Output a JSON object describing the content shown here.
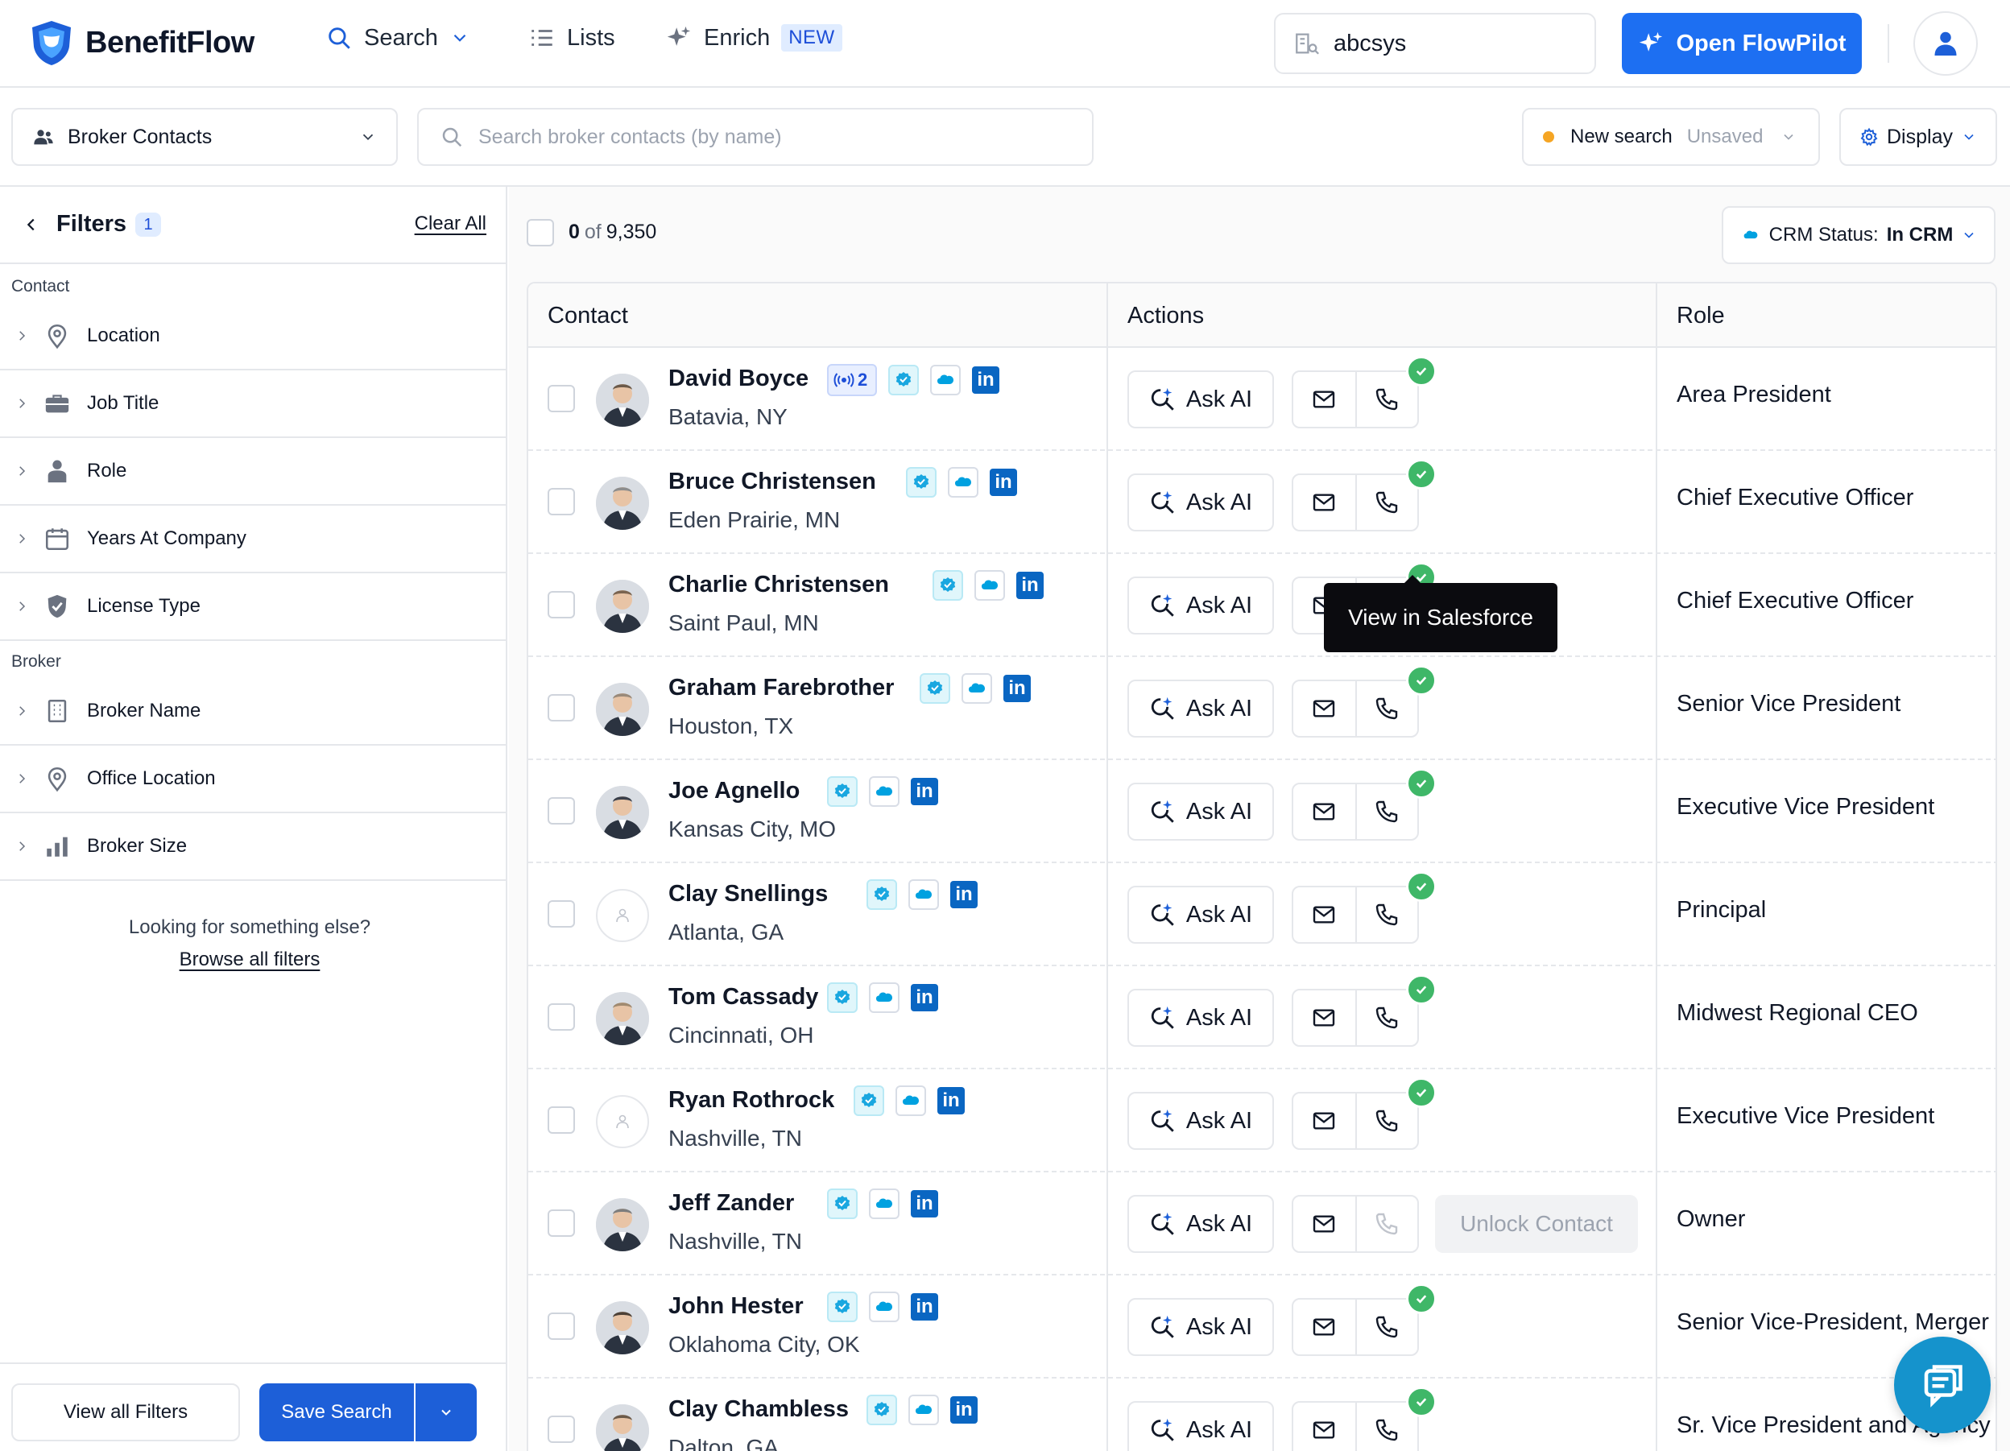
{
  "app": {
    "name": "BenefitFlow"
  },
  "topnav": {
    "search_label": "Search",
    "lists_label": "Lists",
    "enrich_label": "Enrich",
    "enrich_badge": "NEW",
    "company_value": "abcsys",
    "flowpilot_label": "Open FlowPilot"
  },
  "toolbar": {
    "dataset": "Broker Contacts",
    "search_placeholder": "Search broker contacts (by name)",
    "saved_search_name": "New search",
    "saved_search_state": "Unsaved",
    "display_label": "Display"
  },
  "sidebar": {
    "title": "Filters",
    "active_count": "1",
    "clear_all": "Clear All",
    "groups": [
      {
        "label": "Contact",
        "items": [
          {
            "label": "Location",
            "icon": "map-pin-icon"
          },
          {
            "label": "Job Title",
            "icon": "briefcase-icon"
          },
          {
            "label": "Role",
            "icon": "person-icon"
          },
          {
            "label": "Years At Company",
            "icon": "calendar-icon"
          },
          {
            "label": "License Type",
            "icon": "shield-check-icon"
          }
        ]
      },
      {
        "label": "Broker",
        "items": [
          {
            "label": "Broker Name",
            "icon": "building-icon"
          },
          {
            "label": "Office Location",
            "icon": "map-pin-icon"
          },
          {
            "label": "Broker Size",
            "icon": "bar-chart-icon"
          }
        ]
      }
    ],
    "looking_text": "Looking for something else?",
    "browse_all": "Browse all filters",
    "view_all_filters": "View all Filters",
    "save_search": "Save Search"
  },
  "main": {
    "selected": "0",
    "of_label": "of",
    "total": "9,350",
    "crm_status_label": "CRM Status:",
    "crm_status_value": "In CRM",
    "columns": {
      "contact": "Contact",
      "actions": "Actions",
      "role": "Role"
    },
    "ask_ai": "Ask AI",
    "unlock_contact": "Unlock Contact",
    "tooltip": "View in Salesforce",
    "signal_count": "2",
    "rows": [
      {
        "name": "David Boyce",
        "location": "Batavia, NY",
        "role": "Area President",
        "avatar": "photo",
        "unlocked": true,
        "signal": true
      },
      {
        "name": "Bruce Christensen",
        "location": "Eden Prairie, MN",
        "role": "Chief Executive Officer",
        "avatar": "photo",
        "unlocked": true
      },
      {
        "name": "Charlie Christensen",
        "location": "Saint Paul, MN",
        "role": "Chief Executive Officer",
        "avatar": "photo",
        "unlocked": true
      },
      {
        "name": "Graham Farebrother",
        "location": "Houston, TX",
        "role": "Senior Vice President",
        "avatar": "photo",
        "unlocked": true
      },
      {
        "name": "Joe Agnello",
        "location": "Kansas City, MO",
        "role": "Executive Vice President",
        "avatar": "photo",
        "unlocked": true
      },
      {
        "name": "Clay Snellings",
        "location": "Atlanta, GA",
        "role": "Principal",
        "avatar": "placeholder",
        "unlocked": true
      },
      {
        "name": "Tom Cassady",
        "location": "Cincinnati, OH",
        "role": "Midwest Regional CEO",
        "avatar": "photo",
        "unlocked": true
      },
      {
        "name": "Ryan Rothrock",
        "location": "Nashville, TN",
        "role": "Executive Vice President",
        "avatar": "placeholder",
        "unlocked": true
      },
      {
        "name": "Jeff Zander",
        "location": "Nashville, TN",
        "role": "Owner",
        "avatar": "photo",
        "unlocked": false
      },
      {
        "name": "John Hester",
        "location": "Oklahoma City, OK",
        "role": "Senior Vice-President, Merger",
        "avatar": "photo",
        "unlocked": true
      },
      {
        "name": "Clay Chambless",
        "location": "Dalton, GA",
        "role": "Sr. Vice President and Agency",
        "avatar": "photo",
        "unlocked": true
      }
    ]
  },
  "colors": {
    "primary": "#1d6ff2",
    "save_blue": "#1d5fd8",
    "success": "#3fb768",
    "salesforce": "#00a1e0",
    "linkedin": "#0a66c2",
    "chat": "#1593cc"
  }
}
